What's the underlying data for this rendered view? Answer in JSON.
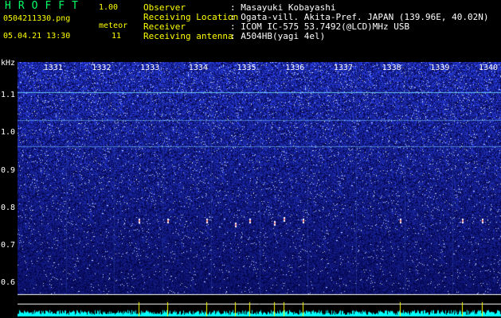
{
  "app": {
    "name": "HROFFT",
    "version": "1.00"
  },
  "file": {
    "name": "0504211330.png",
    "datetime": "05.04.21 13:30"
  },
  "meteor": {
    "label": "meteor",
    "count": "11"
  },
  "info": [
    {
      "key": "Observer",
      "value": ": Masayuki Kobayashi"
    },
    {
      "key": "Receiving Location",
      "value": ": Ogata-vill. Akita-Pref. JAPAN (139.96E, 40.02N)"
    },
    {
      "key": "Receiver",
      "value": ": ICOM IC-575 53.7492(@LCD)MHz USB"
    },
    {
      "key": "Receiving antenna",
      "value": ": A504HB(yagi 4el)"
    }
  ],
  "colors": {
    "header_label": "#ffff00",
    "header_value": "#ffffff",
    "title": "#00ff66",
    "noise": "#00ffff"
  },
  "chart_data": {
    "type": "heatmap",
    "title": "",
    "ylabel": "kHz",
    "xlabel": "",
    "x_ticks": [
      "1331",
      "1332",
      "1333",
      "1334",
      "1335",
      "1336",
      "1337",
      "1338",
      "1339",
      "1340"
    ],
    "x_range": [
      1330,
      1340
    ],
    "y_ticks": [
      "1.1",
      "1.0",
      "0.9",
      "0.8",
      "0.7",
      "0.6"
    ],
    "y_values": [
      1.1,
      1.0,
      0.9,
      0.8,
      0.7,
      0.6
    ],
    "y_range": [
      0.57,
      1.19
    ],
    "carrier_lines_khz": [
      1.11,
      1.035,
      0.965
    ],
    "meteor_echoes": [
      {
        "minute": 1332.5,
        "khz": 0.765
      },
      {
        "minute": 1333.1,
        "khz": 0.765
      },
      {
        "minute": 1333.9,
        "khz": 0.765
      },
      {
        "minute": 1334.5,
        "khz": 0.755
      },
      {
        "minute": 1334.8,
        "khz": 0.765
      },
      {
        "minute": 1335.3,
        "khz": 0.76
      },
      {
        "minute": 1335.5,
        "khz": 0.77
      },
      {
        "minute": 1335.9,
        "khz": 0.765
      },
      {
        "minute": 1337.9,
        "khz": 0.765
      },
      {
        "minute": 1339.2,
        "khz": 0.765
      },
      {
        "minute": 1339.6,
        "khz": 0.765
      }
    ]
  }
}
